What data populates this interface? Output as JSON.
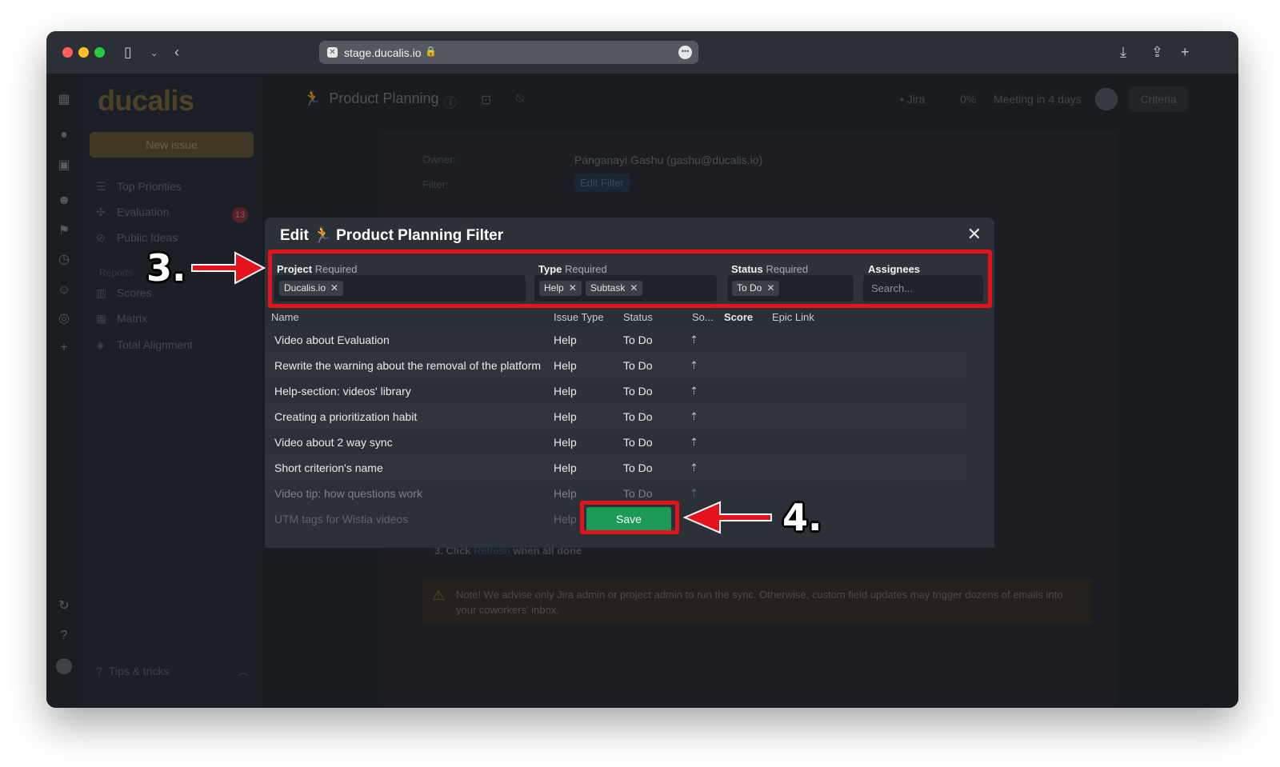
{
  "browser": {
    "url": "stage.ducalis.io"
  },
  "rail": {
    "icons": [
      "grid-icon",
      "bulb-icon",
      "save-icon",
      "emoji-icon",
      "run-icon",
      "clock-icon",
      "face-icon",
      "target-icon",
      "plus-icon",
      "sync-icon",
      "help-icon",
      "avatar-icon"
    ]
  },
  "sidebar": {
    "logo": "ducalis",
    "new_issue": "New issue",
    "items": [
      {
        "label": "Top Priorities"
      },
      {
        "label": "Evaluation",
        "badge": "13"
      },
      {
        "label": "Public Ideas"
      }
    ],
    "reports_header": "Reports",
    "reports": [
      {
        "label": "Scores"
      },
      {
        "label": "Matrix"
      },
      {
        "label": "Total Alignment"
      }
    ],
    "tips": "Tips & tricks"
  },
  "topbar": {
    "title": "Product Planning",
    "jira": "Jira",
    "progress": "0%",
    "meeting": "Meeting in 4 days",
    "criteria": "Criteria"
  },
  "page": {
    "owner_label": "Owner:",
    "owner_value": "Panganayi Gashu (gashu@ducalis.io)",
    "filter_label": "Filter:",
    "edit_filter": "Edit Filter",
    "step3_prefix": "3. Click",
    "step3_link": "Refresh",
    "step3_suffix": "when all done",
    "note": "Note! We advise only Jira admin or project admin to run the sync. Otherwise, custom field updates may trigger dozens of emails into your coworkers' inbox."
  },
  "modal": {
    "title_prefix": "Edit",
    "title_name": "Product Planning Filter",
    "filters": {
      "project": {
        "label": "Project",
        "required": "Required",
        "chips": [
          "Ducalis.io"
        ]
      },
      "type": {
        "label": "Type",
        "required": "Required",
        "chips": [
          "Help",
          "Subtask"
        ]
      },
      "status": {
        "label": "Status",
        "required": "Required",
        "chips": [
          "To Do"
        ]
      },
      "assignees": {
        "label": "Assignees",
        "placeholder": "Search..."
      }
    },
    "columns": [
      "Name",
      "Issue Type",
      "Status",
      "So...",
      "Score",
      "Epic Link"
    ],
    "rows": [
      {
        "name": "Video about Evaluation",
        "type": "Help",
        "status": "To Do"
      },
      {
        "name": "Rewrite the warning about the removal of the platform",
        "type": "Help",
        "status": "To Do"
      },
      {
        "name": "Help-section: videos' library",
        "type": "Help",
        "status": "To Do"
      },
      {
        "name": "Creating a prioritization habit",
        "type": "Help",
        "status": "To Do"
      },
      {
        "name": "Video about 2 way sync",
        "type": "Help",
        "status": "To Do"
      },
      {
        "name": "Short criterion's name",
        "type": "Help",
        "status": "To Do"
      },
      {
        "name": "Video tip: how questions work",
        "type": "Help",
        "status": "To Do"
      },
      {
        "name": "UTM tags for Wistia videos",
        "type": "Help",
        "status": ""
      }
    ],
    "save": "Save"
  },
  "annotations": {
    "step3": "3.",
    "step4": "4.",
    "color": "#e4131c"
  }
}
